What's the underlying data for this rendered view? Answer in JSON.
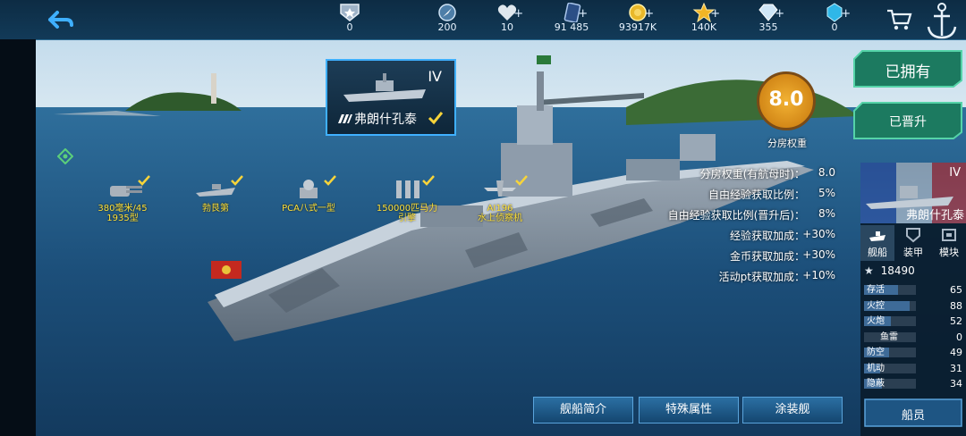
{
  "top_bar": {
    "resources": [
      {
        "icon": "rank-badge-icon",
        "value": "0",
        "has_plus": false
      },
      {
        "icon": "compass-icon",
        "value": "200",
        "has_plus": false
      },
      {
        "icon": "heart-icon",
        "value": "10",
        "has_plus": true
      },
      {
        "icon": "card-icon",
        "value": "91 485",
        "has_plus": true
      },
      {
        "icon": "gold-coin-icon",
        "value": "93917K",
        "has_plus": true
      },
      {
        "icon": "star-icon",
        "value": "140K",
        "has_plus": true
      },
      {
        "icon": "diamond-icon",
        "value": "355",
        "has_plus": true
      },
      {
        "icon": "blue-gem-icon",
        "value": "0",
        "has_plus": true
      }
    ]
  },
  "ship_card": {
    "tier": "IV",
    "name": "弗朗什孔泰"
  },
  "modules": [
    {
      "icon": "turret-icon",
      "label_line1": "380毫米/45",
      "label_line2": "1935型"
    },
    {
      "icon": "destroyer-icon",
      "label_line1": "勃艮第",
      "label_line2": ""
    },
    {
      "icon": "aa-gun-icon",
      "label_line1": "PCA八式一型",
      "label_line2": ""
    },
    {
      "icon": "engine-icon",
      "label_line1": "150000匹马力",
      "label_line2": "引擎"
    },
    {
      "icon": "seaplane-icon",
      "label_line1": "AI196",
      "label_line2": "水上侦察机"
    }
  ],
  "score": {
    "value": "8.0",
    "label": "分房权重"
  },
  "bonuses": [
    {
      "label": "分房权重(有航母时)：",
      "value": "8.0"
    },
    {
      "label": "自由经验获取比例：",
      "value": "5%"
    },
    {
      "label": "自由经验获取比例(晋升后)：",
      "value": "8%"
    },
    {
      "label": "经验获取加成：",
      "value": "+30%"
    },
    {
      "label": "金币获取加成：",
      "value": "+30%"
    },
    {
      "label": "活动pt获取加成：",
      "value": "+10%"
    }
  ],
  "right_buttons": {
    "owned": "已拥有",
    "promoted": "已晋升"
  },
  "side_panel": {
    "tier": "IV",
    "name": "弗朗什孔泰",
    "tabs": [
      {
        "icon": "ship-tab-icon",
        "label": "舰船"
      },
      {
        "icon": "armor-tab-icon",
        "label": "装甲"
      },
      {
        "icon": "module-tab-icon",
        "label": "模块"
      }
    ],
    "rating": "18490",
    "stats": [
      {
        "label": "存活",
        "value": "65",
        "fill": 0.65
      },
      {
        "label": "火控",
        "value": "88",
        "fill": 0.88
      },
      {
        "label": "火炮",
        "value": "52",
        "fill": 0.52
      },
      {
        "label": "鱼雷",
        "value": "0",
        "fill": 0.0
      },
      {
        "label": "防空",
        "value": "49",
        "fill": 0.49
      },
      {
        "label": "机动",
        "value": "31",
        "fill": 0.31
      },
      {
        "label": "隐蔽",
        "value": "34",
        "fill": 0.34
      }
    ],
    "crew_button": "船员"
  },
  "bottom_buttons": [
    "舰船简介",
    "特殊属性",
    "涂装舰"
  ],
  "colors": {
    "accent_blue": "#3fb0ff",
    "module_label": "#ffe23a",
    "score_orange": "#e99a22",
    "button_green": "#1c7a60"
  }
}
